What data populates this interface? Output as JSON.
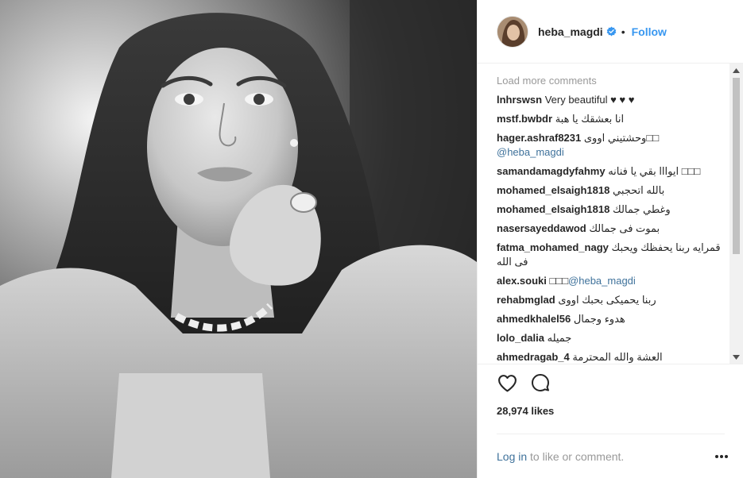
{
  "post": {
    "username": "heba_magdi",
    "follow_label": "Follow",
    "separator": "•"
  },
  "comments": {
    "load_more": "Load more comments",
    "items": [
      {
        "user": "lnhrswsn",
        "text": " Very beautiful ♥ ♥ ♥",
        "mention": ""
      },
      {
        "user": "mstf.bwbdr",
        "text": " انا بعشقك يا هبة",
        "mention": ""
      },
      {
        "user": "hager.ashraf8231",
        "text": " وحشتيني اووى□□",
        "mention": "@heba_magdi"
      },
      {
        "user": "samandamagdyfahmy",
        "text": " ايوااا بقي يا فنانه □□□",
        "mention": ""
      },
      {
        "user": "mohamed_elsaigh1818",
        "text": " بالله اتحجبي",
        "mention": ""
      },
      {
        "user": "mohamed_elsaigh1818",
        "text": " وغطي جمالك",
        "mention": ""
      },
      {
        "user": "nasersayeddawod",
        "text": " بموت فى جمالك",
        "mention": ""
      },
      {
        "user": "fatma_mohamed_nagy",
        "text": " قمرايه ربنا يحفظك ويحبك فى الله",
        "mention": ""
      },
      {
        "user": "alex.souki",
        "text": " □□□",
        "mention": "@heba_magdi"
      },
      {
        "user": "rehabmglad",
        "text": " ربنا يحميكى بحبك اووى",
        "mention": ""
      },
      {
        "user": "ahmedkhalel56",
        "text": " هدوء وجمال",
        "mention": ""
      },
      {
        "user": "lolo_dalia",
        "text": " جميله",
        "mention": ""
      },
      {
        "user": "ahmedragab_4",
        "text": " العشة والله المحترمة",
        "mention": ""
      }
    ]
  },
  "actions": {
    "likes": "28,974 likes"
  },
  "footer": {
    "login_link": "Log in",
    "login_rest": " to like or comment."
  },
  "icons": {
    "verified": "verified-badge-icon",
    "like": "heart-icon",
    "comment": "comment-bubble-icon",
    "more": "more-options-icon"
  },
  "colors": {
    "link": "#3897f0",
    "mention": "#3f729b",
    "muted": "#999999",
    "text": "#262626"
  }
}
